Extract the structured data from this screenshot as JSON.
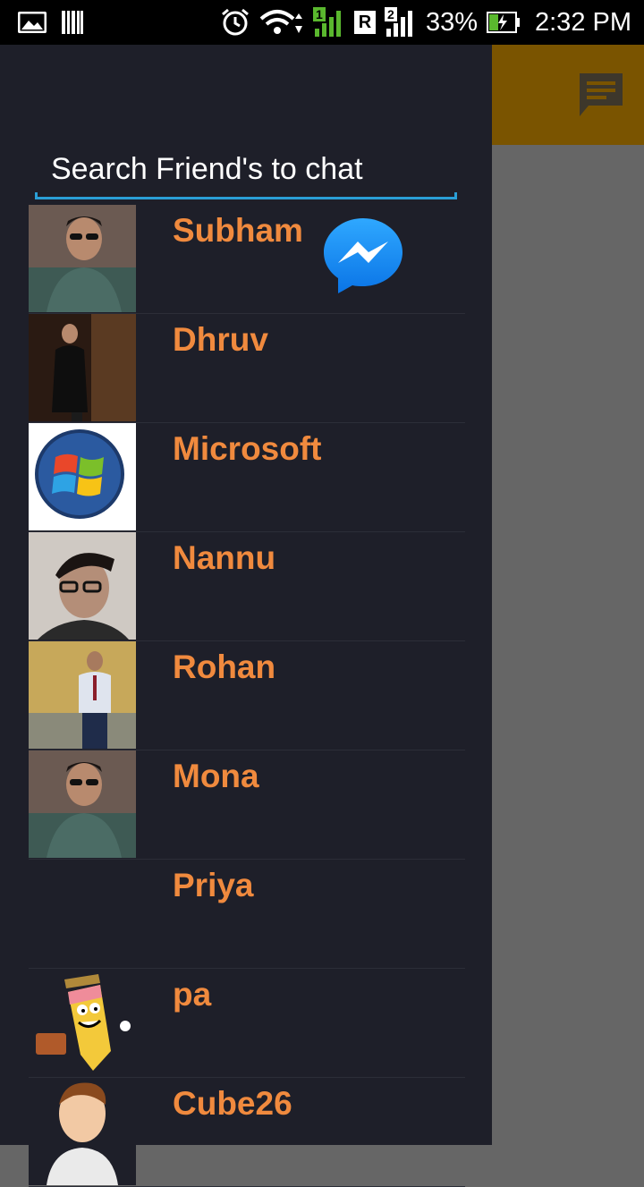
{
  "status_bar": {
    "battery_percent": "33%",
    "time": "2:32 PM",
    "sim1_label": "1",
    "sim2_label": "2",
    "roaming_label": "R",
    "icons": [
      "gallery-icon",
      "barcode-icon",
      "alarm-icon",
      "wifi-icon",
      "signal-icon",
      "battery-charging-icon"
    ]
  },
  "app_bar": {
    "icon": "chat-message-icon",
    "color": "#7a5400"
  },
  "drawer": {
    "search": {
      "placeholder": "Search Friend's to chat"
    },
    "contacts": [
      {
        "name": "Subham",
        "avatar": "photo-man-sunglasses"
      },
      {
        "name": "Dhruv",
        "avatar": "photo-man-black-coat"
      },
      {
        "name": "Microsoft",
        "avatar": "windows-logo"
      },
      {
        "name": "Nannu",
        "avatar": "photo-man-glasses"
      },
      {
        "name": "Rohan",
        "avatar": "photo-man-tie"
      },
      {
        "name": "Mona",
        "avatar": "photo-man-sunglasses"
      },
      {
        "name": "Priya",
        "avatar": ""
      },
      {
        "name": "pa",
        "avatar": "pencil-cartoon"
      },
      {
        "name": "Cube26",
        "avatar": "cartoon-man"
      }
    ]
  },
  "floating": {
    "icon": "messenger-chat-head-icon"
  },
  "colors": {
    "drawer_bg": "#1e1f29",
    "name_text": "#f08a3e",
    "search_underline": "#2a9fd6",
    "content_bg": "#666666"
  }
}
